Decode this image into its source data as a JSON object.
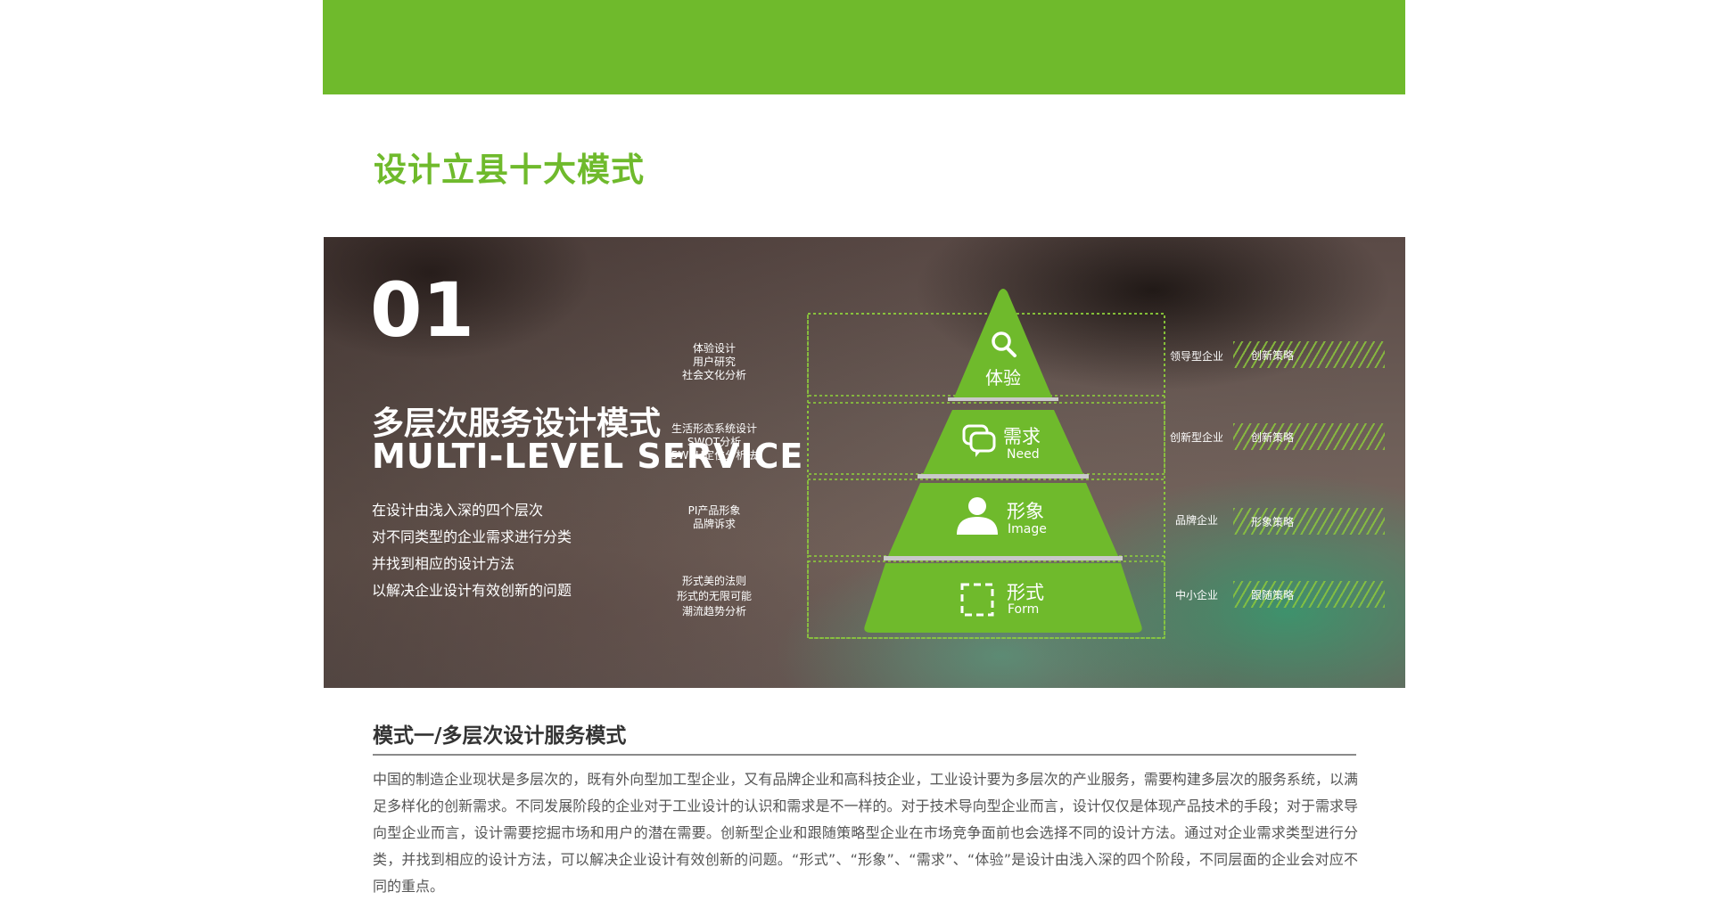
{
  "page": {
    "title": "设计立县十大模式"
  },
  "banner": {
    "number": "01",
    "title_cn": "多层次服务设计模式",
    "title_en": "MULTI-LEVEL SERVICE",
    "description": [
      "在设计由浅入深的四个层次",
      "对不同类型的企业需求进行分类",
      "并找到相应的设计方法",
      "以解决企业设计有效创新的问题"
    ],
    "pyramid": {
      "tiers": [
        {
          "cn": "体验",
          "en": "",
          "icon": "search-icon",
          "methods": [
            "体验设计",
            "用户研究",
            "社会文化分析"
          ],
          "enterprise": "领导型企业",
          "strategy": "创新策略"
        },
        {
          "cn": "需求",
          "en": "Need",
          "icon": "chat-bubbles-icon",
          "methods": [
            "生活形态系统设计",
            "SWOT分析",
            "5W1H定位分析法"
          ],
          "enterprise": "创新型企业",
          "strategy": "创新策略"
        },
        {
          "cn": "形象",
          "en": "Image",
          "icon": "user-icon",
          "methods": [
            "PI产品形象",
            "品牌诉求"
          ],
          "enterprise": "品牌企业",
          "strategy": "形象策略"
        },
        {
          "cn": "形式",
          "en": "Form",
          "icon": "dashed-square-icon",
          "methods": [
            "形式美的法则",
            "形式的无限可能",
            "潮流趋势分析"
          ],
          "enterprise": "中小企业",
          "strategy": "跟随策略"
        }
      ]
    },
    "colors": {
      "accent": "#6fba2c"
    }
  },
  "section": {
    "title": "模式一/多层次设计服务模式",
    "body": "中国的制造企业现状是多层次的，既有外向型加工型企业，又有品牌企业和高科技企业，工业设计要为多层次的产业服务，需要构建多层次的服务系统，以满足多样化的创新需求。不同发展阶段的企业对于工业设计的认识和需求是不一样的。对于技术导向型企业而言，设计仅仅是体现产品技术的手段；对于需求导向型企业而言，设计需要挖掘市场和用户的潜在需要。创新型企业和跟随策略型企业在市场竞争面前也会选择不同的设计方法。通过对企业需求类型进行分类，并找到相应的设计方法，可以解决企业设计有效创新的问题。“形式”、“形象”、“需求”、“体验”是设计由浅入深的四个阶段，不同层面的企业会对应不同的重点。"
  }
}
